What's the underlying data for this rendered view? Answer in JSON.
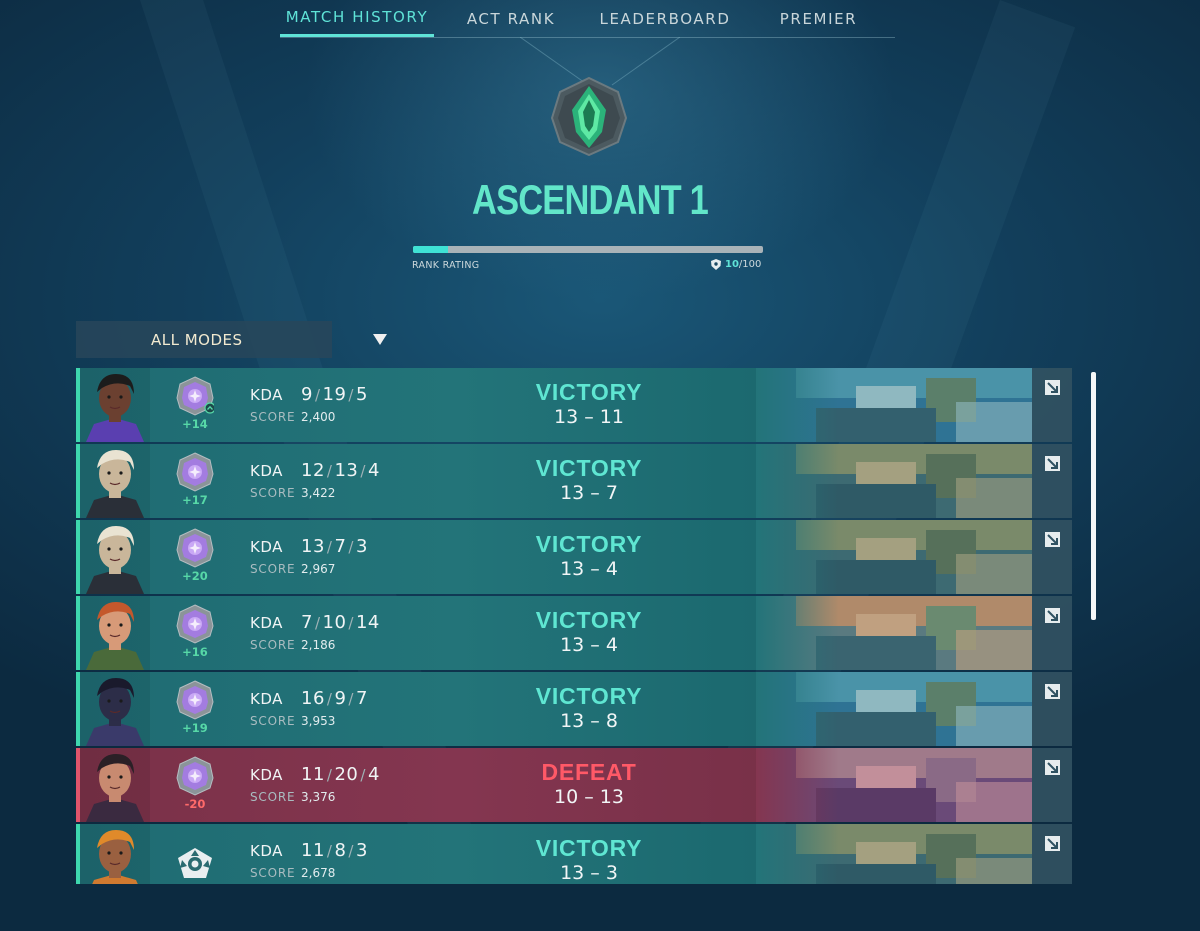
{
  "tabs": [
    {
      "label": "MATCH HISTORY",
      "active": true
    },
    {
      "label": "ACT RANK",
      "active": false
    },
    {
      "label": "LEADERBOARD",
      "active": false
    },
    {
      "label": "PREMIER",
      "active": false
    }
  ],
  "rank": {
    "title": "ASCENDANT 1",
    "rating_label": "RANK RATING",
    "rating_current": "10",
    "rating_max": "/100",
    "rating_fraction": 0.1,
    "emblem_icon": "ascendant-emblem-icon"
  },
  "filter": {
    "label": "ALL MODES"
  },
  "labels": {
    "kda": "KDA",
    "score": "SCORE"
  },
  "colors": {
    "accent": "#5fe3d7",
    "victory": "#5fe6d2",
    "defeat": "#ff5967",
    "win_row": "#237479",
    "loss_row": "#843650"
  },
  "matches": [
    {
      "agent": "Ekko",
      "k": "9",
      "d": "19",
      "a": "5",
      "score": "2,400",
      "rr": "+14",
      "result": "VICTORY",
      "team": "13",
      "enemy": "11",
      "outcome": "win",
      "map_tone": "blue",
      "ranked": true,
      "promo": true
    },
    {
      "agent": "Deadlock",
      "k": "12",
      "d": "13",
      "a": "4",
      "score": "3,422",
      "rr": "+17",
      "result": "VICTORY",
      "team": "13",
      "enemy": "7",
      "outcome": "win",
      "map_tone": "olive",
      "ranked": true,
      "promo": false
    },
    {
      "agent": "Deadlock",
      "k": "13",
      "d": "7",
      "a": "3",
      "score": "2,967",
      "rr": "+20",
      "result": "VICTORY",
      "team": "13",
      "enemy": "4",
      "outcome": "win",
      "map_tone": "olive",
      "ranked": true,
      "promo": false
    },
    {
      "agent": "Skye",
      "k": "7",
      "d": "10",
      "a": "14",
      "score": "2,186",
      "rr": "+16",
      "result": "VICTORY",
      "team": "13",
      "enemy": "4",
      "outcome": "win",
      "map_tone": "city",
      "ranked": true,
      "promo": false
    },
    {
      "agent": "Iso",
      "k": "16",
      "d": "9",
      "a": "7",
      "score": "3,953",
      "rr": "+19",
      "result": "VICTORY",
      "team": "13",
      "enemy": "8",
      "outcome": "win",
      "map_tone": "blue",
      "ranked": true,
      "promo": false
    },
    {
      "agent": "Reyna",
      "k": "11",
      "d": "20",
      "a": "4",
      "score": "3,376",
      "rr": "-20",
      "result": "DEFEAT",
      "team": "10",
      "enemy": "13",
      "outcome": "loss",
      "map_tone": "purple",
      "ranked": true,
      "promo": false
    },
    {
      "agent": "Raze",
      "k": "11",
      "d": "8",
      "a": "3",
      "score": "2,678",
      "rr": "",
      "result": "VICTORY",
      "team": "13",
      "enemy": "3",
      "outcome": "win",
      "map_tone": "olive",
      "ranked": false,
      "promo": false
    }
  ]
}
